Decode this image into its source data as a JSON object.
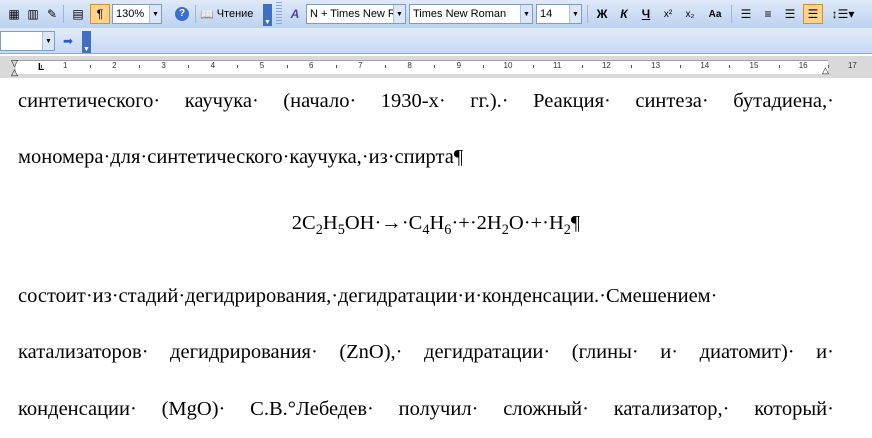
{
  "toolbar": {
    "zoom": "130%",
    "read_label": "Чтение",
    "style_combo": "N + Times New R",
    "font_combo": "Times New Roman",
    "size_combo": "14",
    "bold_glyph": "Ж",
    "italic_glyph": "К",
    "underline_glyph": "Ч",
    "super_glyph": "x²",
    "sub_glyph": "x₂",
    "case_glyph": "Aa"
  },
  "ruler": {
    "numbers": [
      "1",
      "2",
      "3",
      "4",
      "5",
      "6",
      "7",
      "8",
      "9",
      "10",
      "11",
      "12",
      "13",
      "14",
      "15",
      "16",
      "17"
    ]
  },
  "document": {
    "line1_words": [
      "синтетического·",
      "каучука·",
      "(начало·",
      "1930-х·",
      "гг.).·",
      "Реакция·",
      "синтеза·",
      "бутадиена,·"
    ],
    "line2": "мономера·для·синтетического·каучука,·из·спирта¶",
    "equation": {
      "part1": "2C",
      "sub1": "2",
      "part2": "H",
      "sub2": "5",
      "part3": "OH·→·C",
      "sub3": "4",
      "part4": "H",
      "sub4": "6",
      "part5": "·+·2H",
      "sub5": "2",
      "part6": "O·+·H",
      "sub6": "2",
      "part7": "¶"
    },
    "line4": "состоит·из·стадий·дегидрирования,·дегидратации·и·конденсации.·Смешением·",
    "line5_words": [
      "катализаторов·",
      "дегидрирования·",
      "(ZnO),·",
      "дегидратации·",
      "(глины·",
      "и·",
      "диатомит)·",
      "и·"
    ],
    "line6_words": [
      "конденсации·",
      "(MgO)·",
      "С.В.°Лебедев·",
      "получил·",
      "сложный·",
      "катализатор,·",
      "который·"
    ]
  }
}
